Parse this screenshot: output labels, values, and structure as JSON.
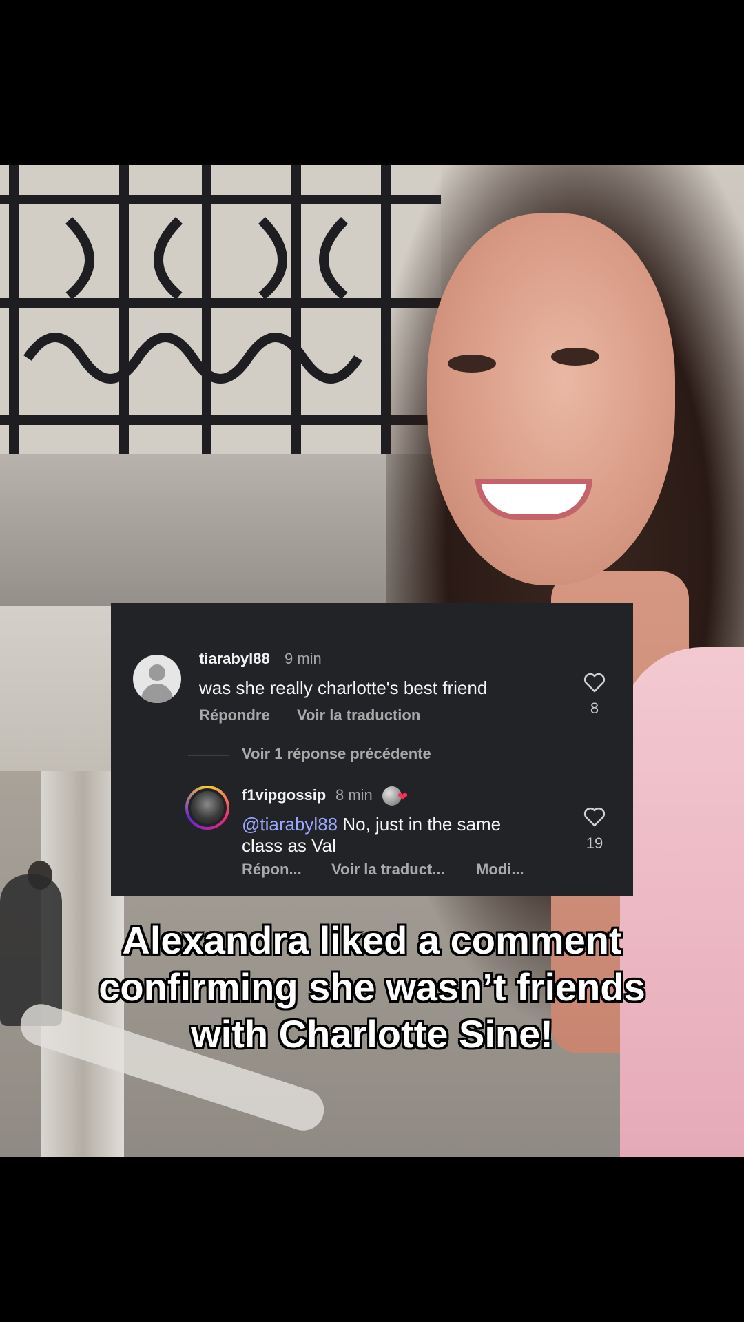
{
  "comment1": {
    "username": "tiarabyl88",
    "time": "9 min",
    "text": "was she really charlotte's best friend",
    "reply_label": "Répondre",
    "translate_label": "Voir la traduction",
    "likes": "8"
  },
  "previous_replies_label": "Voir 1 réponse précédente",
  "comment2": {
    "username": "f1vipgossip",
    "time": "8 min",
    "mention": "@tiarabyl88",
    "text": " No, just in the same class as Val",
    "reply_label": "Répon...",
    "translate_label": "Voir la traduct...",
    "modify_label": "Modi...",
    "likes": "19",
    "liked_by_creator_icon": "creator-heart-icon"
  },
  "caption": {
    "line1": "Alexandra liked a comment",
    "line2": "confirming she wasn’t friends",
    "line3": "with Charlotte Sine!"
  },
  "colors": {
    "card_bg": "#222327",
    "mention": "#9aa7ff",
    "like_heart": "#ff2d55"
  }
}
